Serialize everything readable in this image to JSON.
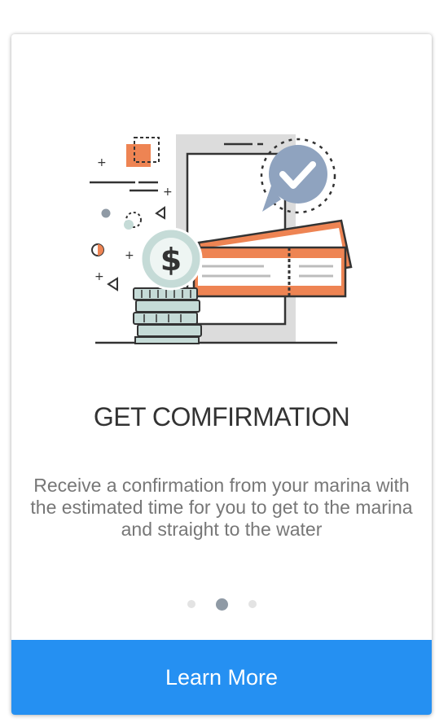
{
  "onboarding": {
    "title": "GET COMFIRMATION",
    "description": "Receive a confirmation from your marina with the estimated time for you to get to the marina and straight to the water",
    "pager": {
      "total": 3,
      "active_index": 1
    },
    "cta_label": "Learn More"
  },
  "illustration": {
    "currency_symbol": "$",
    "icons": [
      "phone-icon",
      "checkmark-bubble-icon",
      "ticket-icon",
      "dollar-coin-icon",
      "coin-stack-icon"
    ]
  },
  "colors": {
    "accent_blue": "#2590f2",
    "orange": "#ee8453",
    "teal_coin": "#c5dbd7",
    "check_bubble": "#8fa3bf",
    "dot_active": "#8f9aa5",
    "dot_inactive": "#e3e3e3"
  }
}
